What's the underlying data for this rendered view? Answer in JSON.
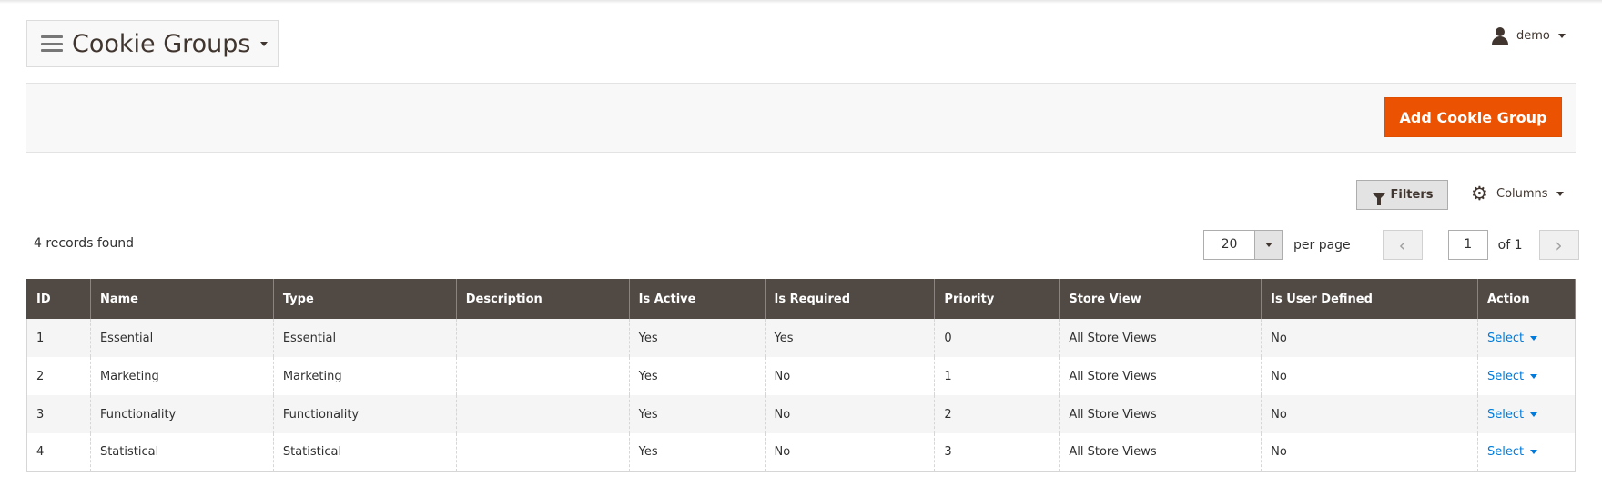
{
  "header": {
    "title": "Cookie Groups",
    "user": "demo"
  },
  "actions": {
    "add_label": "Add Cookie Group"
  },
  "toolbar": {
    "filters_label": "Filters",
    "columns_label": "Columns",
    "records_found": "4 records found",
    "per_page_value": "20",
    "per_page_label": "per page",
    "current_page": "1",
    "page_total": "of 1"
  },
  "table": {
    "columns": [
      "ID",
      "Name",
      "Type",
      "Description",
      "Is Active",
      "Is Required",
      "Priority",
      "Store View",
      "Is User Defined",
      "Action"
    ],
    "rows": [
      {
        "id": "1",
        "name": "Essential",
        "type": "Essential",
        "description": "",
        "is_active": "Yes",
        "is_required": "Yes",
        "priority": "0",
        "store_view": "All Store Views",
        "is_user_defined": "No",
        "action": "Select"
      },
      {
        "id": "2",
        "name": "Marketing",
        "type": "Marketing",
        "description": "",
        "is_active": "Yes",
        "is_required": "No",
        "priority": "1",
        "store_view": "All Store Views",
        "is_user_defined": "No",
        "action": "Select"
      },
      {
        "id": "3",
        "name": "Functionality",
        "type": "Functionality",
        "description": "",
        "is_active": "Yes",
        "is_required": "No",
        "priority": "2",
        "store_view": "All Store Views",
        "is_user_defined": "No",
        "action": "Select"
      },
      {
        "id": "4",
        "name": "Statistical",
        "type": "Statistical",
        "description": "",
        "is_active": "Yes",
        "is_required": "No",
        "priority": "3",
        "store_view": "All Store Views",
        "is_user_defined": "No",
        "action": "Select"
      }
    ]
  },
  "colors": {
    "accent": "#eb5202",
    "header_bg": "#514943",
    "link": "#007bdb"
  },
  "icons": {
    "menu": "hamburger-icon",
    "user": "user-icon",
    "filter": "funnel-icon",
    "columns": "gear-icon",
    "prev": "chevron-left-icon",
    "next": "chevron-right-icon"
  }
}
